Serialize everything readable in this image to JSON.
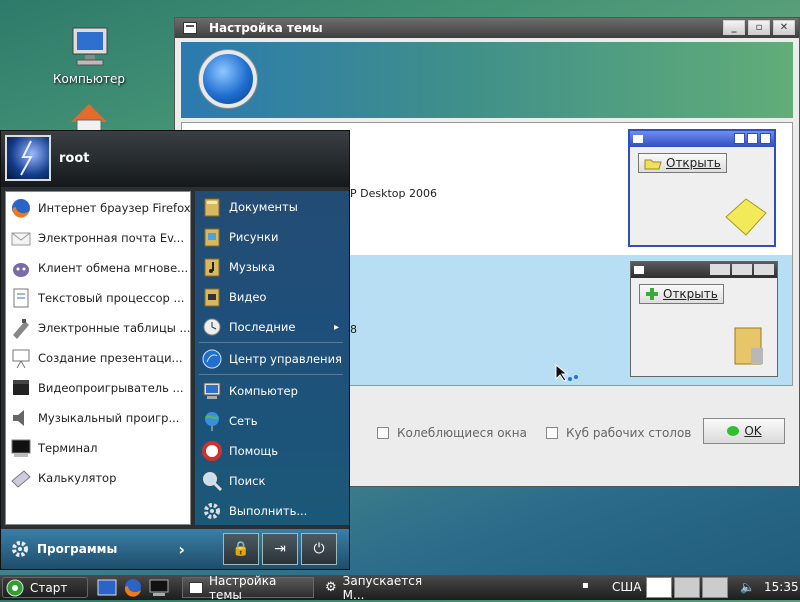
{
  "desktop": {
    "icons": [
      {
        "label": "Компьютер",
        "icon": "computer-icon"
      },
      {
        "label": "",
        "icon": "home-icon"
      }
    ]
  },
  "theme_window": {
    "title": "Настройка темы",
    "buttons": {
      "minimize": "_",
      "maximize": "▫",
      "close": "✕"
    },
    "themes": [
      {
        "name": "P Desktop 2006",
        "selected": false,
        "preview_button": "Открыть",
        "preview_color": "#2f4fbf"
      },
      {
        "name": "8",
        "selected": true,
        "preview_button": "Открыть",
        "preview_color": "#3a3a3a"
      }
    ],
    "options": {
      "wobbly": "Колеблющиеся окна",
      "cube": "Куб рабочих столов"
    },
    "ok_label": "OK"
  },
  "start_menu": {
    "user": "root",
    "favorites": [
      {
        "label": "Интернет браузер Firefox",
        "icon": "firefox-icon"
      },
      {
        "label": "Электронная почта Ev...",
        "icon": "mail-icon"
      },
      {
        "label": "Клиент обмена мгнове...",
        "icon": "chat-icon"
      },
      {
        "label": "Текстовый процессор ...",
        "icon": "writer-icon"
      },
      {
        "label": "Электронные таблицы ...",
        "icon": "spreadsheet-icon"
      },
      {
        "label": "Создание презентаци...",
        "icon": "presentation-icon"
      },
      {
        "label": "Видеопроигрыватель ...",
        "icon": "video-player-icon"
      },
      {
        "label": "Музыкальный проигр...",
        "icon": "music-player-icon"
      },
      {
        "label": "Терминал",
        "icon": "terminal-icon"
      },
      {
        "label": "Калькулятор",
        "icon": "calculator-icon"
      }
    ],
    "places": [
      {
        "label": "Документы",
        "icon": "documents-folder-icon"
      },
      {
        "label": "Рисунки",
        "icon": "pictures-folder-icon"
      },
      {
        "label": "Музыка",
        "icon": "music-folder-icon"
      },
      {
        "label": "Видео",
        "icon": "video-folder-icon"
      },
      {
        "label": "Последние",
        "icon": "recent-icon",
        "arrow": "▸"
      },
      {
        "label": "Центр управления",
        "icon": "control-center-icon"
      },
      {
        "label": "Компьютер",
        "icon": "computer-icon"
      },
      {
        "label": "Сеть",
        "icon": "network-icon"
      },
      {
        "label": "Помощь",
        "icon": "help-icon"
      },
      {
        "label": "Поиск",
        "icon": "search-icon"
      },
      {
        "label": "Выполнить...",
        "icon": "run-icon"
      }
    ],
    "programs_label": "Программы",
    "programs_arrow": "›",
    "footer_buttons": {
      "lock": "🔒",
      "logout": "⇥",
      "power": "⏻"
    }
  },
  "taskbar": {
    "start_label": "Старт",
    "tasks": [
      {
        "label": "Настройка темы",
        "active": true
      },
      {
        "label": "Запускается М...",
        "active": false
      }
    ],
    "layout": "США",
    "clock": "15:35",
    "colors": {
      "accent": "#3a7fa6",
      "selection": "#b7def2"
    }
  }
}
